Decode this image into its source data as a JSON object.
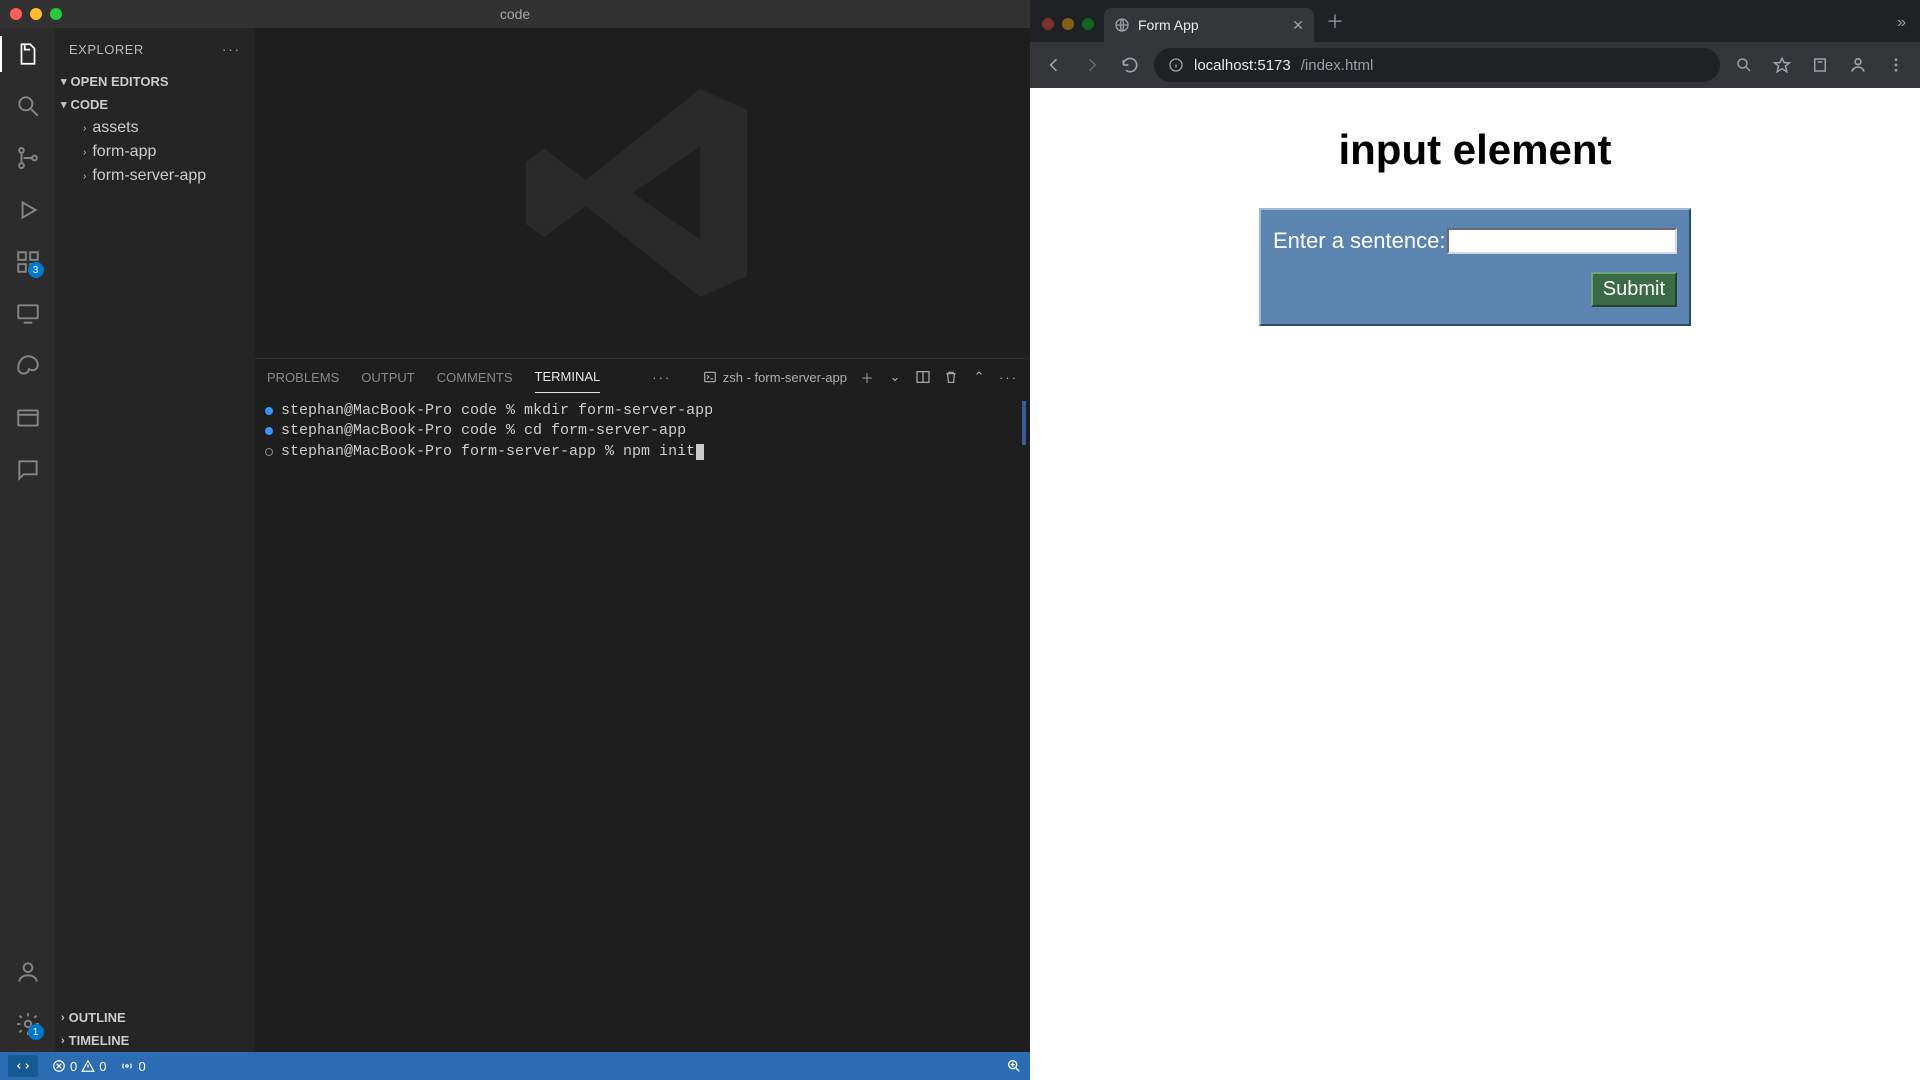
{
  "vscode": {
    "window_title": "code",
    "explorer": {
      "title": "EXPLORER",
      "sections": {
        "open_editors": "OPEN EDITORS",
        "code": "CODE",
        "outline": "OUTLINE",
        "timeline": "TIMELINE"
      },
      "tree": [
        {
          "label": "assets"
        },
        {
          "label": "form-app"
        },
        {
          "label": "form-server-app"
        }
      ]
    },
    "activity_badges": {
      "extensions": "3",
      "settings": "1"
    },
    "panel": {
      "tabs": {
        "problems": "PROBLEMS",
        "output": "OUTPUT",
        "comments": "COMMENTS",
        "terminal": "TERMINAL"
      },
      "shell_label": "zsh - form-server-app"
    },
    "terminal": {
      "lines": [
        "stephan@MacBook-Pro code % mkdir form-server-app",
        "stephan@MacBook-Pro code % cd form-server-app",
        "stephan@MacBook-Pro form-server-app % npm init"
      ]
    },
    "statusbar": {
      "errors": "0",
      "warnings": "0",
      "ports": "0"
    }
  },
  "browser": {
    "tab_title": "Form App",
    "url_host": "localhost:5173",
    "url_path": "/index.html",
    "page": {
      "heading": "input element",
      "label": "Enter a sentence:",
      "submit": "Submit"
    }
  }
}
